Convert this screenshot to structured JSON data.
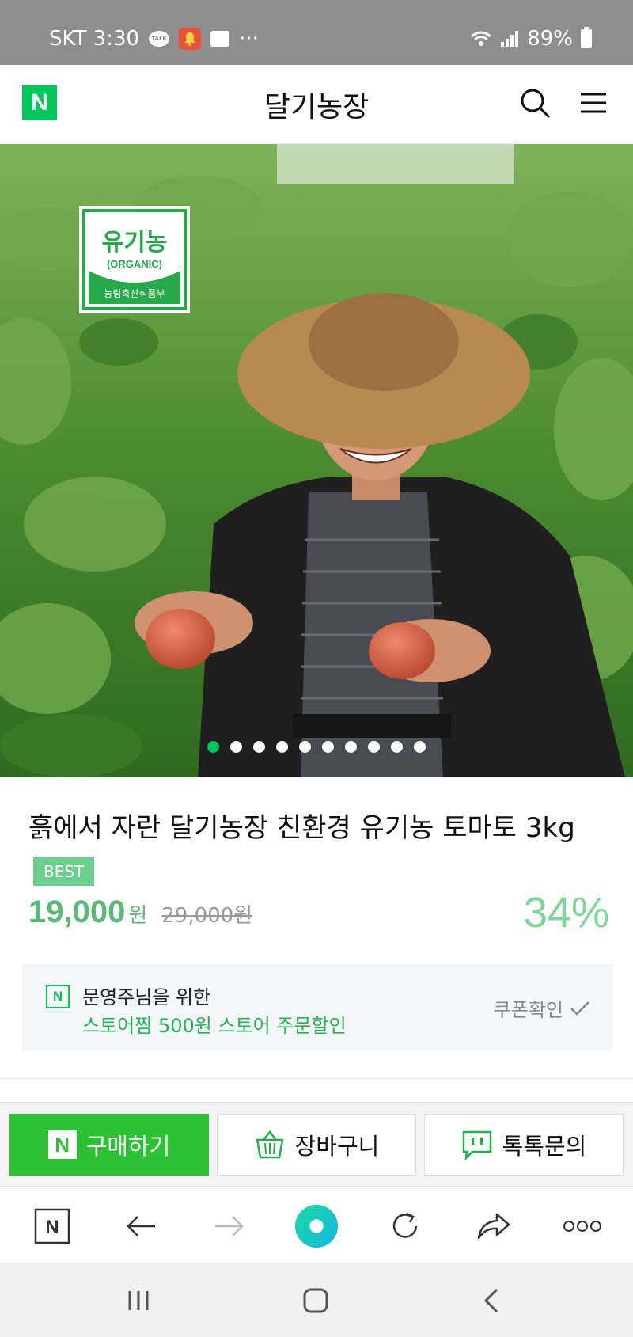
{
  "status_bar": {
    "carrier_time": "SKT 3:30",
    "more": "···",
    "battery": "89%",
    "icons": [
      "talk-icon",
      "bell-icon",
      "message-icon",
      "wifi-icon",
      "signal-icon",
      "battery-icon"
    ]
  },
  "header": {
    "logo": "N",
    "title": "달기농장",
    "icons": [
      "search-icon",
      "menu-icon"
    ]
  },
  "hero": {
    "badge_title": "유기농",
    "badge_subtitle": "(ORGANIC)",
    "badge_footer": "농림축산식품부",
    "slide_count": 10,
    "active_slide": 1
  },
  "product": {
    "title": "흙에서 자란 달기농장 친환경 유기농 토마토 3kg",
    "badge": "BEST",
    "sale_price": "19,000",
    "sale_unit": "원",
    "original_price": "29,000원",
    "discount": "34%"
  },
  "coupon": {
    "icon": "N",
    "line1": "문영주님을 위한",
    "line2": "스토어찜 500원 스토어 주문할인",
    "check_label": "쿠폰확인"
  },
  "actions": {
    "buy_label": "구매하기",
    "cart_label": "장바구니",
    "talk_label": "톡톡문의"
  },
  "browser_bar": {
    "icons": [
      "naver-home-icon",
      "back-arrow-icon",
      "forward-arrow-icon",
      "green-dot-icon",
      "refresh-icon",
      "share-icon",
      "more-icon"
    ]
  },
  "nav_bar": {
    "icons": [
      "recent-apps-icon",
      "home-icon",
      "back-icon"
    ]
  },
  "colors": {
    "naver_green": "#03c75a",
    "buy_button": "#2cc233",
    "price_green": "#5ab977",
    "status_bar": "#8e8e8e"
  }
}
